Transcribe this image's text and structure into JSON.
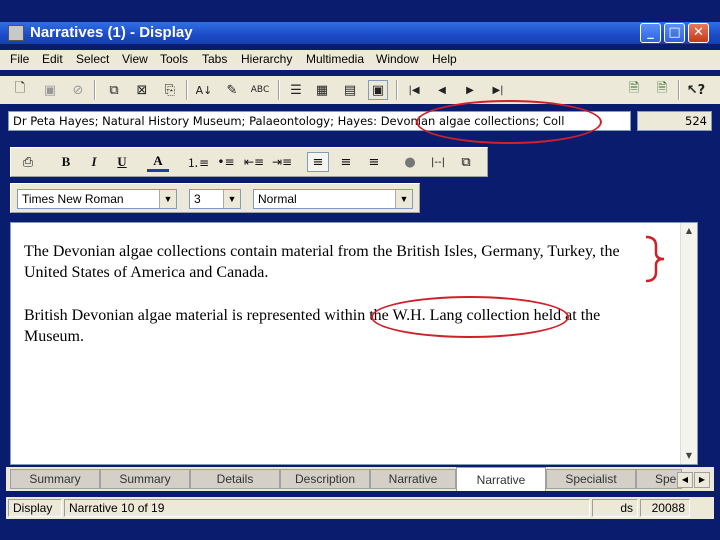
{
  "window": {
    "title": "Narratives (1) - Display",
    "controls": {
      "minimize": "_",
      "maximize": "□",
      "close": "✕"
    }
  },
  "menubar": [
    "File",
    "Edit",
    "Select",
    "View",
    "Tools",
    "Tabs",
    "Hierarchy",
    "Multimedia",
    "Window",
    "Help"
  ],
  "toolbar": {
    "icons": [
      "new-icon",
      "save-icon",
      "stop-icon",
      "copy-record-icon",
      "delete-record-icon",
      "paste-record-icon",
      "sort-icon",
      "edit-icon",
      "spellcheck-icon",
      "list-view-icon",
      "table-view-icon",
      "page-view-icon",
      "display-view-icon",
      "first-record-icon",
      "previous-record-icon",
      "next-record-icon",
      "last-record-icon",
      "attach-icon",
      "detach-icon",
      "help-icon"
    ]
  },
  "path": {
    "value": "Dr Peta Hayes; Natural History Museum; Palaeontology; Hayes: Devonian algae collections; Coll",
    "count": "524"
  },
  "format_toolbar": {
    "buttons": [
      "print-icon",
      "bold-button",
      "italic-button",
      "underline-button",
      "font-color-icon",
      "numbered-list-icon",
      "bullet-list-icon",
      "outdent-icon",
      "indent-icon",
      "align-left-icon",
      "align-center-icon",
      "align-right-icon",
      "image-icon",
      "horizontal-rule-icon",
      "insert-object-icon"
    ],
    "labels": {
      "bold": "B",
      "italic": "I",
      "underline": "U",
      "font_color": "A"
    }
  },
  "font_controls": {
    "font": "Times New Roman",
    "size": "3",
    "style": "Normal"
  },
  "document": {
    "paragraph1": "The Devonian algae collections contain material from the British Isles, Germany, Turkey, the United States of America and Canada.",
    "paragraph2": "British Devonian algae material is represented within the W.H. Lang collection held at the Museum."
  },
  "tabs": [
    "Summary",
    "Summary",
    "Details",
    "Description",
    "Narrative",
    "Narrative",
    "Specialist",
    "Spe"
  ],
  "active_tab_index": 5,
  "status": {
    "mode": "Display",
    "record": "Narrative 10 of 19",
    "user": "ds",
    "id": "20088"
  },
  "colors": {
    "title_bar": "#2f6fe3",
    "annotation": "#d0202a",
    "desktop_border": "#0a1c6e"
  }
}
